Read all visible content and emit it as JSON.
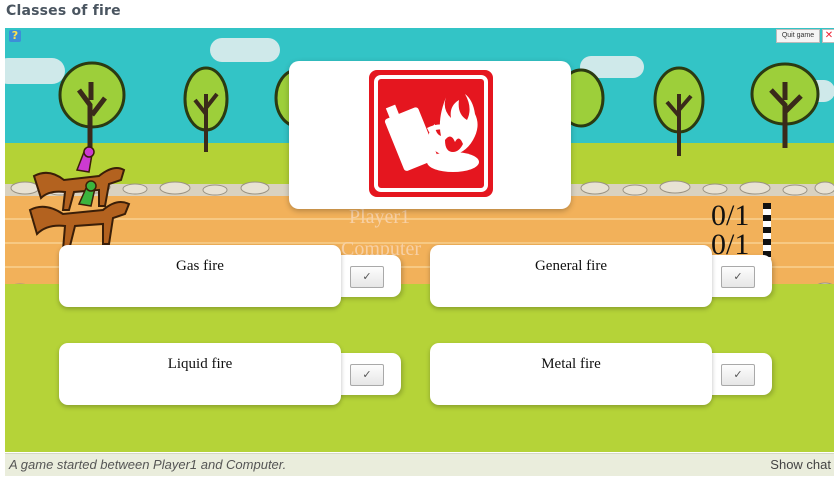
{
  "page": {
    "title": "Classes of fire"
  },
  "toolbar": {
    "help_label": "?",
    "quit_label": "Quit game",
    "close_label": "✕"
  },
  "question": {
    "icon": "fire-extinguisher-class-b-sign",
    "colors": {
      "sign_red": "#e5161f",
      "sign_white": "#ffffff"
    }
  },
  "players": [
    {
      "name": "Player1",
      "score": "0/1"
    },
    {
      "name": "Computer",
      "score": "0/1"
    }
  ],
  "answers": [
    {
      "label": "Gas fire",
      "check_label": "✓"
    },
    {
      "label": "General fire",
      "check_label": "✓"
    },
    {
      "label": "Liquid fire",
      "check_label": "✓"
    },
    {
      "label": "Metal fire",
      "check_label": "✓"
    }
  ],
  "status": {
    "message": "A game started between Player1 and Computer.",
    "chat_label": "Show chat"
  },
  "colors": {
    "sky": "#33c4c6",
    "grass": "#b5d338",
    "track": "#f2b15a"
  }
}
